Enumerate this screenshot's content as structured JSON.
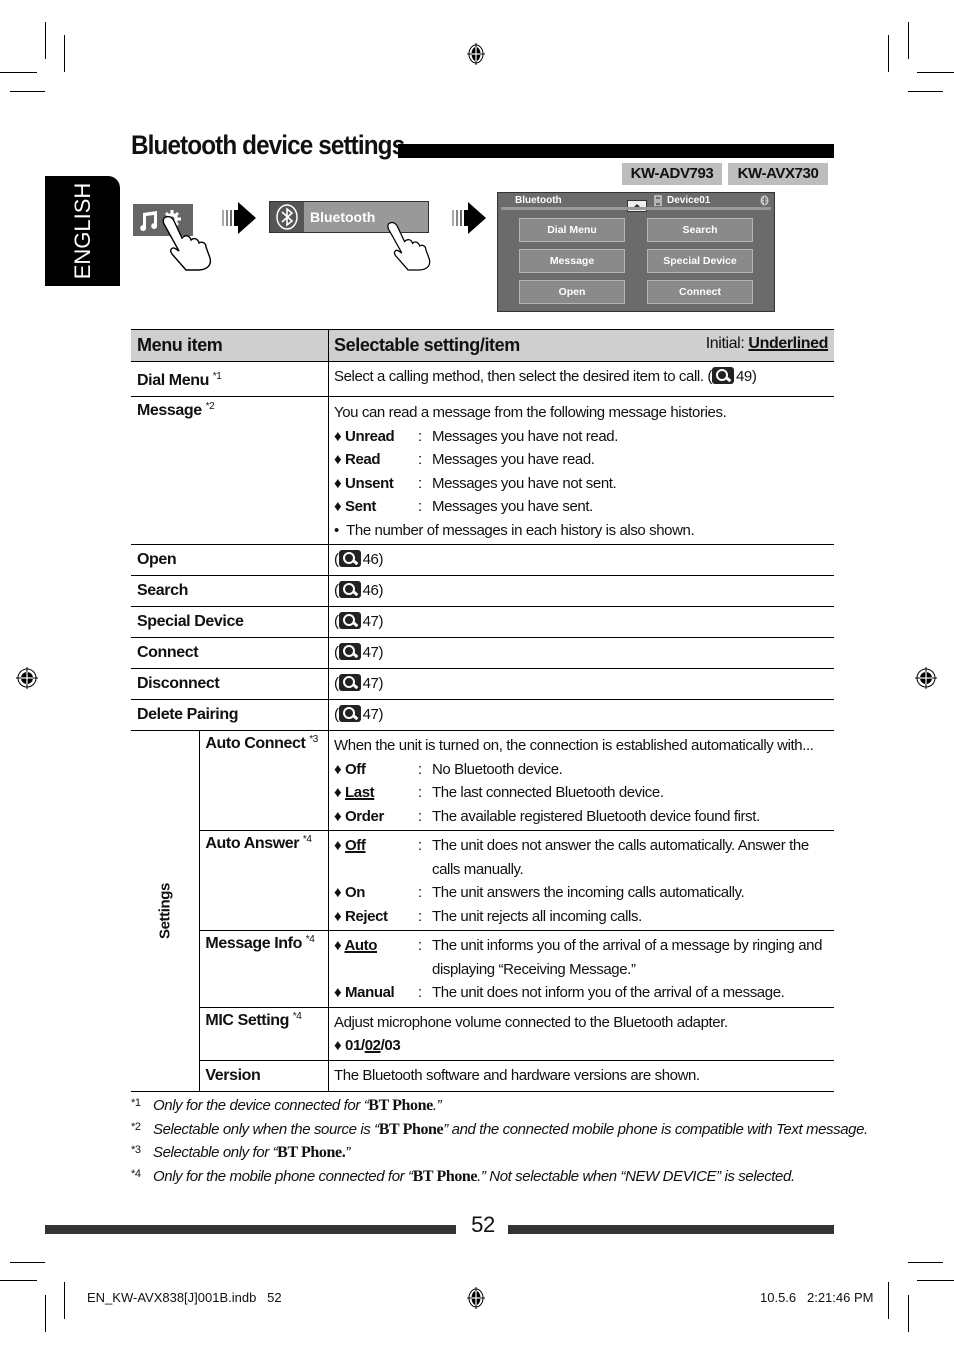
{
  "title": "Bluetooth device settings",
  "models": [
    "KW-ADV793",
    "KW-AVX730"
  ],
  "language_tab": "ENGLISH",
  "flow": {
    "step2_label": "Bluetooth",
    "screen": {
      "title": "Bluetooth",
      "device": "Device01",
      "buttons": [
        "Dial Menu",
        "Search",
        "Message",
        "Special Device",
        "Open",
        "Connect"
      ]
    }
  },
  "table": {
    "header_menu": "Menu item",
    "header_setting": "Selectable setting/item",
    "initial_label": "Initial:",
    "initial_value": "Underlined",
    "rows": {
      "dial_menu": {
        "name": "Dial Menu",
        "note": "*1",
        "text": "Select a calling method, then select the desired item to call. (",
        "page": "49)"
      },
      "message": {
        "name": "Message",
        "note": "*2",
        "intro": "You can read a message from the following message histories.",
        "options": [
          {
            "key": "Unread",
            "desc": "Messages you have not read."
          },
          {
            "key": "Read",
            "desc": "Messages you have read."
          },
          {
            "key": "Unsent",
            "desc": "Messages you have not sent."
          },
          {
            "key": "Sent",
            "desc": "Messages you have sent."
          }
        ],
        "bullet": "The number of messages in each history is also shown."
      },
      "open": {
        "name": "Open",
        "page": "46)"
      },
      "search": {
        "name": "Search",
        "page": "46)"
      },
      "special_device": {
        "name": "Special Device",
        "page": "47)"
      },
      "connect": {
        "name": "Connect",
        "page": "47)"
      },
      "disconnect": {
        "name": "Disconnect",
        "page": "47)"
      },
      "delete_pairing": {
        "name": "Delete Pairing",
        "page": "47)"
      }
    },
    "settings_label": "Settings",
    "settings": {
      "auto_connect": {
        "name": "Auto Connect",
        "note": "*3",
        "intro": "When the unit is turned on, the connection is established automatically with...",
        "options": [
          {
            "key": "Off",
            "desc": "No Bluetooth device."
          },
          {
            "key": "Last",
            "desc": "The last connected Bluetooth device.",
            "initial": true
          },
          {
            "key": "Order",
            "desc": "The available registered Bluetooth device found first."
          }
        ]
      },
      "auto_answer": {
        "name": "Auto Answer",
        "note": "*4",
        "options": [
          {
            "key": "Off",
            "desc": "The unit does not answer the calls automatically. Answer the calls manually.",
            "initial": true
          },
          {
            "key": "On",
            "desc": "The unit answers the incoming calls automatically."
          },
          {
            "key": "Reject",
            "desc": "The unit rejects all incoming calls."
          }
        ]
      },
      "message_info": {
        "name": "Message Info",
        "note": "*4",
        "options": [
          {
            "key": "Auto",
            "desc": "The unit informs you of the arrival of a message by ringing and displaying “Receiving Message.”",
            "initial": true
          },
          {
            "key": "Manual",
            "desc": "The unit does not inform you of the arrival of a message."
          }
        ]
      },
      "mic_setting": {
        "name": "MIC Setting",
        "note": "*4",
        "intro": "Adjust microphone volume connected to the Bluetooth adapter.",
        "values": [
          "01",
          "02",
          "03"
        ],
        "initial": "02"
      },
      "version": {
        "name": "Version",
        "text": "The Bluetooth software and hardware versions are shown."
      }
    }
  },
  "footnotes": [
    {
      "mark": "*1",
      "pre": "Only for the device connected for “",
      "bold": "BT Phone",
      "post": ".”"
    },
    {
      "mark": "*2",
      "pre": "Selectable only when the source is “",
      "bold": "BT Phone",
      "post": "” and the connected mobile phone is compatible with Text message."
    },
    {
      "mark": "*3",
      "pre": "Selectable only for “",
      "bold": "BT Phone.",
      "post": "”"
    },
    {
      "mark": "*4",
      "pre": "Only for the mobile phone connected for “",
      "bold": "BT Phone",
      "post": ".” Not selectable when “NEW DEVICE” is selected."
    }
  ],
  "page_number": "52",
  "print_info": {
    "file": "EN_KW-AVX838[J]001B.indb   52",
    "timestamp": "10.5.6   2:21:46 PM"
  }
}
